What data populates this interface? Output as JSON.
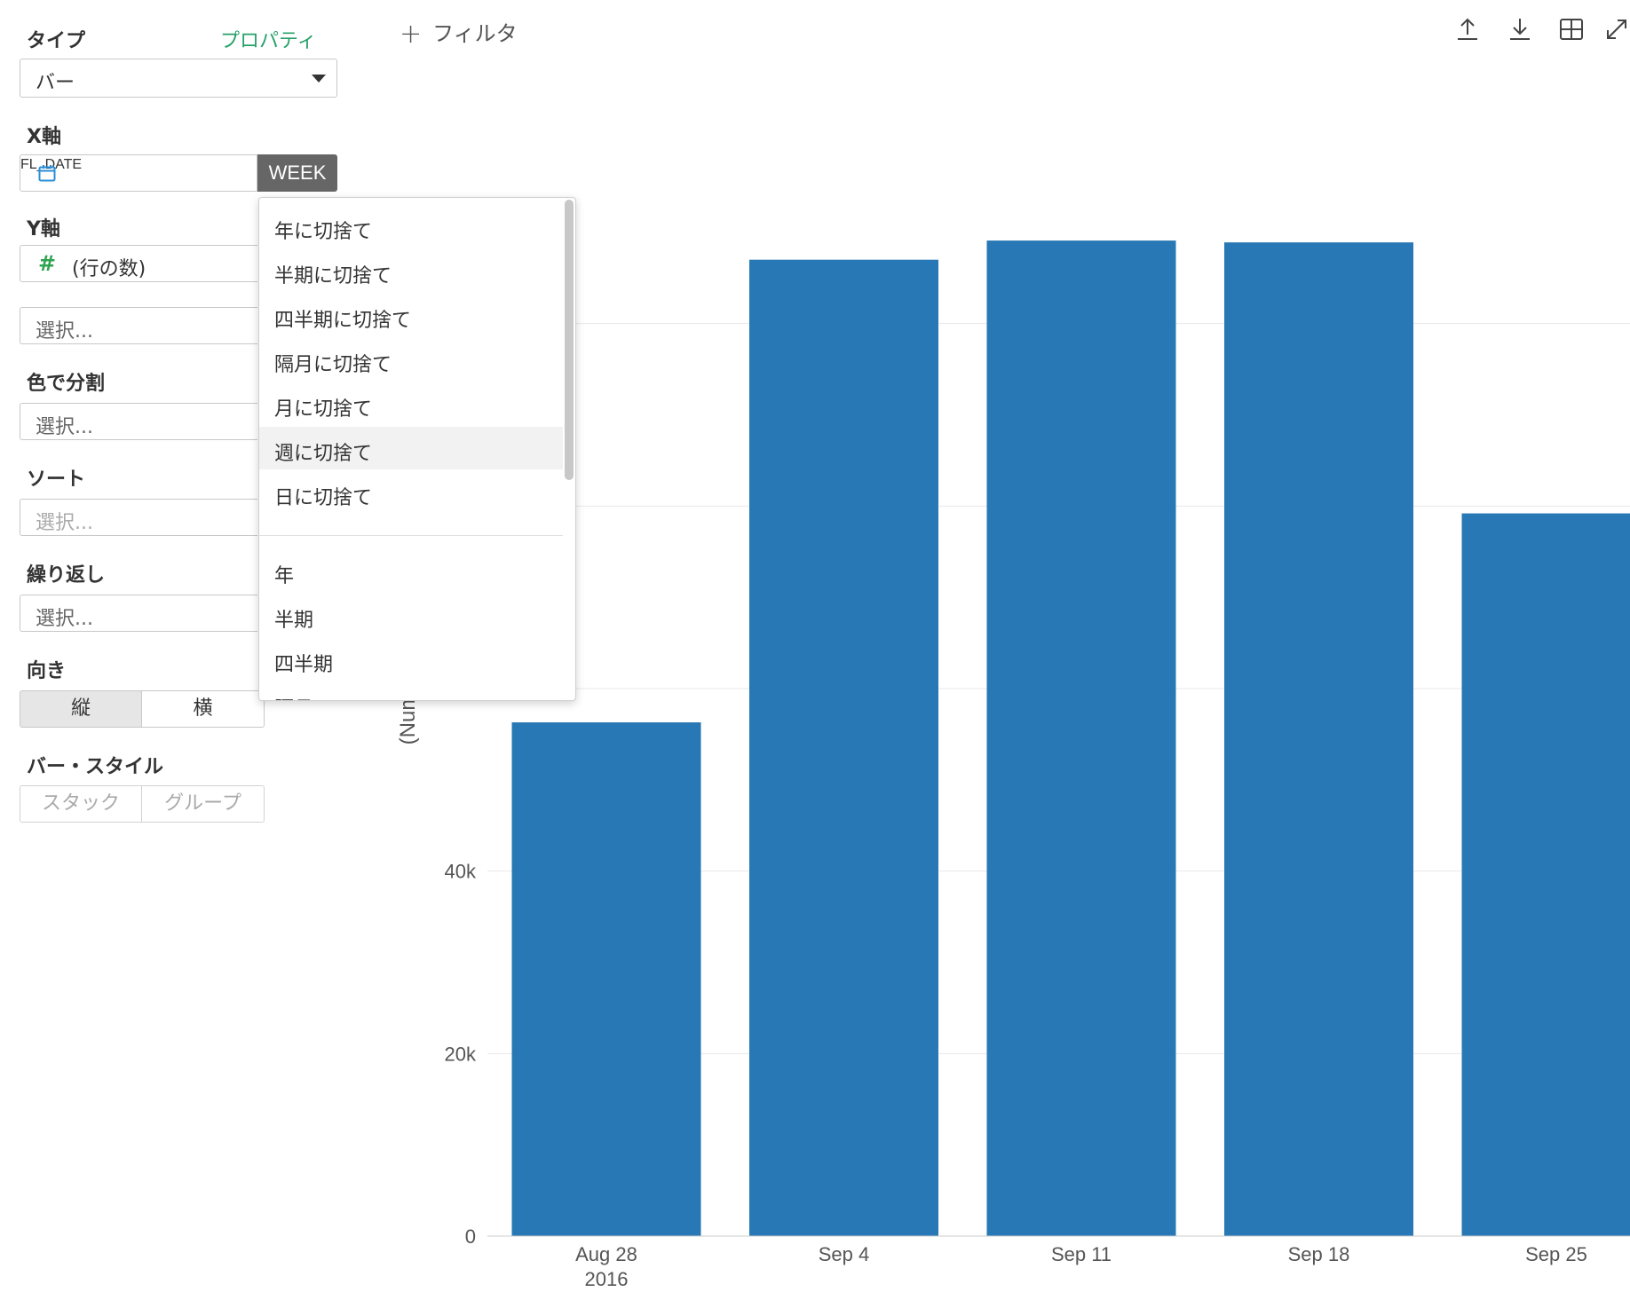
{
  "sidebar": {
    "type_label": "タイプ",
    "properties_link": "プロパティ",
    "type_value": "バー",
    "x_axis_label": "X軸",
    "x_field": "FL_DATE",
    "x_unit_button": "WEEK",
    "y_axis_label": "Y軸",
    "y_field": "(行の数)",
    "y_extra_placeholder": "選択...",
    "color_label": "色で分割",
    "color_placeholder": "選択...",
    "sort_label": "ソート",
    "sort_placeholder": "選択...",
    "repeat_label": "繰り返し",
    "repeat_placeholder": "選択...",
    "orientation_label": "向き",
    "orientation_vertical": "縦",
    "orientation_horizontal": "横",
    "bar_style_label": "バー・スタイル",
    "bar_style_stack": "スタック",
    "bar_style_group": "グループ"
  },
  "toolbar": {
    "filter_label": "フィルタ",
    "icons": [
      "upload-icon",
      "download-icon",
      "table-icon",
      "expand-icon"
    ]
  },
  "dropdown": {
    "items": [
      {
        "label": "年に切捨て",
        "highlighted": false
      },
      {
        "label": "半期に切捨て",
        "highlighted": false
      },
      {
        "label": "四半期に切捨て",
        "highlighted": false
      },
      {
        "label": "隔月に切捨て",
        "highlighted": false
      },
      {
        "label": "月に切捨て",
        "highlighted": false
      },
      {
        "label": "週に切捨て",
        "highlighted": true
      },
      {
        "label": "日に切捨て",
        "highlighted": false
      }
    ],
    "items2": [
      {
        "label": "年"
      },
      {
        "label": "半期"
      },
      {
        "label": "四半期"
      },
      {
        "label": "隔月"
      }
    ]
  },
  "chart_data": {
    "type": "bar",
    "categories": [
      "Aug 28",
      "Sep 4",
      "Sep 11",
      "Sep 18",
      "Sep 25"
    ],
    "category_sublabels": [
      "2016",
      "",
      "",
      "",
      ""
    ],
    "values": [
      56300,
      107000,
      109100,
      108900,
      79200
    ],
    "ylabel": "(Num",
    "yticks": [
      0,
      20000,
      40000
    ],
    "ytick_labels": [
      "0",
      "20k",
      "40k"
    ],
    "gridlines": [
      60000,
      80000,
      100000
    ],
    "ylim": [
      0,
      120000
    ],
    "bar_color": "#2878b5"
  }
}
